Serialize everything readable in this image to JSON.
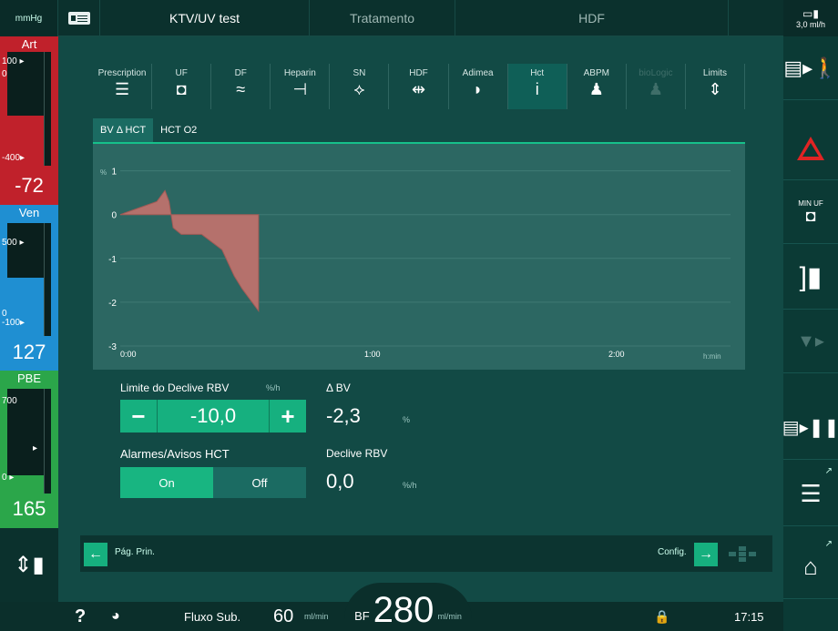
{
  "header": {
    "unit": "mmHg",
    "patient": "KTV/UV test",
    "mode": "Tratamento",
    "therapy": "HDF",
    "battery_value": "3,0",
    "battery_unit": "ml/h"
  },
  "pressures": {
    "art": {
      "label": "Art",
      "upper": "100",
      "lower": "0",
      "limit": "-400",
      "value": "-72"
    },
    "ven": {
      "label": "Ven",
      "upper": "500",
      "lower1": "0",
      "lower2": "-100",
      "value": "127"
    },
    "pbe": {
      "label": "PBE",
      "upper": "700",
      "lower": "0",
      "value": "165"
    }
  },
  "tabs": [
    {
      "label": "Prescription",
      "icon": "sliders-icon",
      "glyph": "☰"
    },
    {
      "label": "UF",
      "icon": "uf-icon",
      "glyph": "◘"
    },
    {
      "label": "DF",
      "icon": "wave-icon",
      "glyph": "≈"
    },
    {
      "label": "Heparin",
      "icon": "syringe-icon",
      "glyph": "⊣"
    },
    {
      "label": "SN",
      "icon": "single-needle-icon",
      "glyph": "⟡"
    },
    {
      "label": "HDF",
      "icon": "hdf-icon",
      "glyph": "⇹"
    },
    {
      "label": "Adimea",
      "icon": "adimea-icon",
      "glyph": "◗"
    },
    {
      "label": "Hct",
      "icon": "hct-icon",
      "glyph": "i"
    },
    {
      "label": "ABPM",
      "icon": "person-icon",
      "glyph": "♟"
    },
    {
      "label": "bioLogic",
      "icon": "biologic-icon",
      "glyph": "♟"
    },
    {
      "label": "Limits",
      "icon": "limits-icon",
      "glyph": "⇕"
    }
  ],
  "subtabs": [
    "BV Δ HCT",
    "HCT O2"
  ],
  "chart_data": {
    "type": "area",
    "ylabel": "%",
    "xlabel": "h:min",
    "x_ticks": [
      "0:00",
      "1:00",
      "2:00"
    ],
    "y_ticks": [
      "1",
      "0",
      "-1",
      "-2",
      "-3"
    ],
    "ylim": [
      -3,
      1.2
    ],
    "xlim_minutes": [
      0,
      150
    ],
    "series": [
      {
        "x": [
          0,
          3,
          6,
          9,
          11,
          12,
          13,
          15,
          20,
          25,
          28,
          30,
          34
        ],
        "y": [
          0,
          0.1,
          0.2,
          0.3,
          0.55,
          0.3,
          -0.3,
          -0.45,
          -0.45,
          -0.8,
          -1.4,
          -1.7,
          -2.2
        ]
      }
    ],
    "color": "#b5716c"
  },
  "controls": {
    "slope_label": "Limite do Declive RBV",
    "slope_unit": "%/h",
    "slope_value": "-10,0",
    "minus": "−",
    "plus": "+",
    "dbv_label": "Δ BV",
    "dbv_value": "-2,3",
    "dbv_unit": "%",
    "alarm_label": "Alarmes/Avisos HCT",
    "on": "On",
    "off": "Off",
    "rbv_label": "Declive RBV",
    "rbv_value": "0,0",
    "rbv_unit": "%/h"
  },
  "nav": {
    "back_label": "Pág. Prin.",
    "config_label": "Config."
  },
  "status": {
    "help": "?",
    "flow_label": "Fluxo Sub.",
    "flow_value": "60",
    "flow_unit": "ml/min",
    "bf_label": "BF",
    "bf_value": "280",
    "bf_unit": "ml/min",
    "time": "17:15"
  },
  "right": {
    "min_uf": "MIN UF"
  }
}
